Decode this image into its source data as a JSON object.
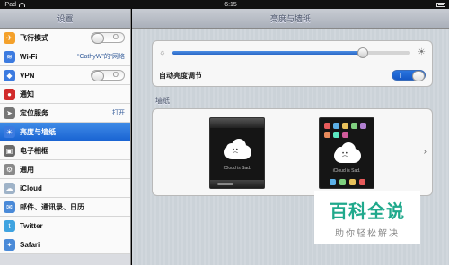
{
  "status_bar": {
    "device": "iPad",
    "time": "6:15"
  },
  "sidebar": {
    "title": "设置",
    "items": [
      {
        "label": "飞行模式",
        "icon": "airplane-icon",
        "color": "#f4a12b",
        "value": "",
        "control": "switch-off"
      },
      {
        "label": "Wi-Fi",
        "icon": "wifi-icon",
        "color": "#3c7be0",
        "value": "“CathyW”的“网络",
        "control": ""
      },
      {
        "label": "VPN",
        "icon": "vpn-icon",
        "color": "#3c7be0",
        "value": "",
        "control": "switch-off"
      },
      {
        "label": "通知",
        "icon": "notification-icon",
        "color": "#d12b2b",
        "value": "",
        "control": ""
      },
      {
        "label": "定位服务",
        "icon": "location-icon",
        "color": "#777777",
        "value": "打开",
        "control": ""
      },
      {
        "label": "亮度与墙纸",
        "icon": "brightness-icon",
        "color": "#3c7be0",
        "value": "",
        "control": "",
        "selected": true
      },
      {
        "label": "电子相框",
        "icon": "picture-frame-icon",
        "color": "#6b6b6b",
        "value": "",
        "control": ""
      },
      {
        "label": "通用",
        "icon": "gear-icon",
        "color": "#8a8a8a",
        "value": "",
        "control": ""
      },
      {
        "label": "iCloud",
        "icon": "cloud-icon",
        "color": "#9fb3c8",
        "value": "",
        "control": ""
      },
      {
        "label": "邮件、通讯录、日历",
        "icon": "mail-icon",
        "color": "#4a8ad8",
        "value": "",
        "control": ""
      },
      {
        "label": "Twitter",
        "icon": "twitter-icon",
        "color": "#3fa3e0",
        "value": "",
        "control": ""
      },
      {
        "label": "Safari",
        "icon": "safari-icon",
        "color": "#4a8ad8",
        "value": "",
        "control": ""
      }
    ]
  },
  "main": {
    "title": "亮度与墙纸",
    "brightness": {
      "level": 0.8,
      "auto_label": "自动亮度调节",
      "auto_on": true
    },
    "wallpaper": {
      "section_title": "墙纸",
      "lock_status_text": "iCloud is Sad.",
      "home_status_text": "iCloud is Sad."
    }
  },
  "watermark": {
    "title": "百科全说",
    "subtitle": "助你轻松解决"
  }
}
